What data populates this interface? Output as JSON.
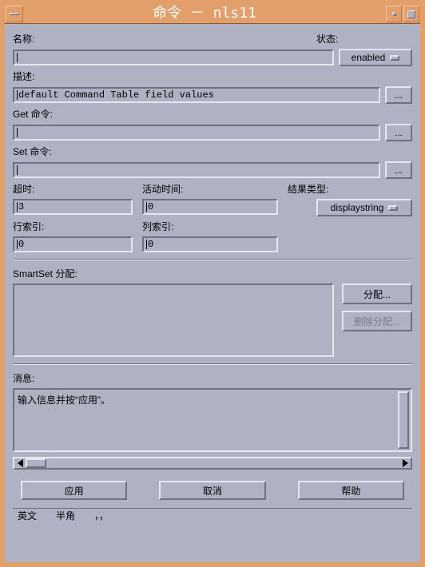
{
  "window": {
    "title": "命令 － nls11"
  },
  "labels": {
    "name": "名称:",
    "state": "状态:",
    "desc": "描述:",
    "get_cmd": "Get 命令:",
    "set_cmd": "Set 命令:",
    "timeout": "超时:",
    "active_time": "活动时间:",
    "result_type": "结果类型:",
    "row_index": "行索引:",
    "col_index": "列索引:",
    "smartset": "SmartSet 分配:",
    "message": "消息:"
  },
  "fields": {
    "name": "",
    "desc": "default Command Table field values",
    "get_cmd": "",
    "set_cmd": "",
    "timeout": "3",
    "active_time": "0",
    "row_index": "0",
    "col_index": "0"
  },
  "options": {
    "state": "enabled",
    "result_type": "displaystring"
  },
  "buttons": {
    "ellipsis": "...",
    "assign": "分配...",
    "unassign": "删除分配...",
    "apply": "应用",
    "cancel": "取消",
    "help": "帮助"
  },
  "message_text": "输入信息并按“应用”。",
  "status": {
    "lang": "英文",
    "width": "半角",
    "extra": "，，"
  }
}
